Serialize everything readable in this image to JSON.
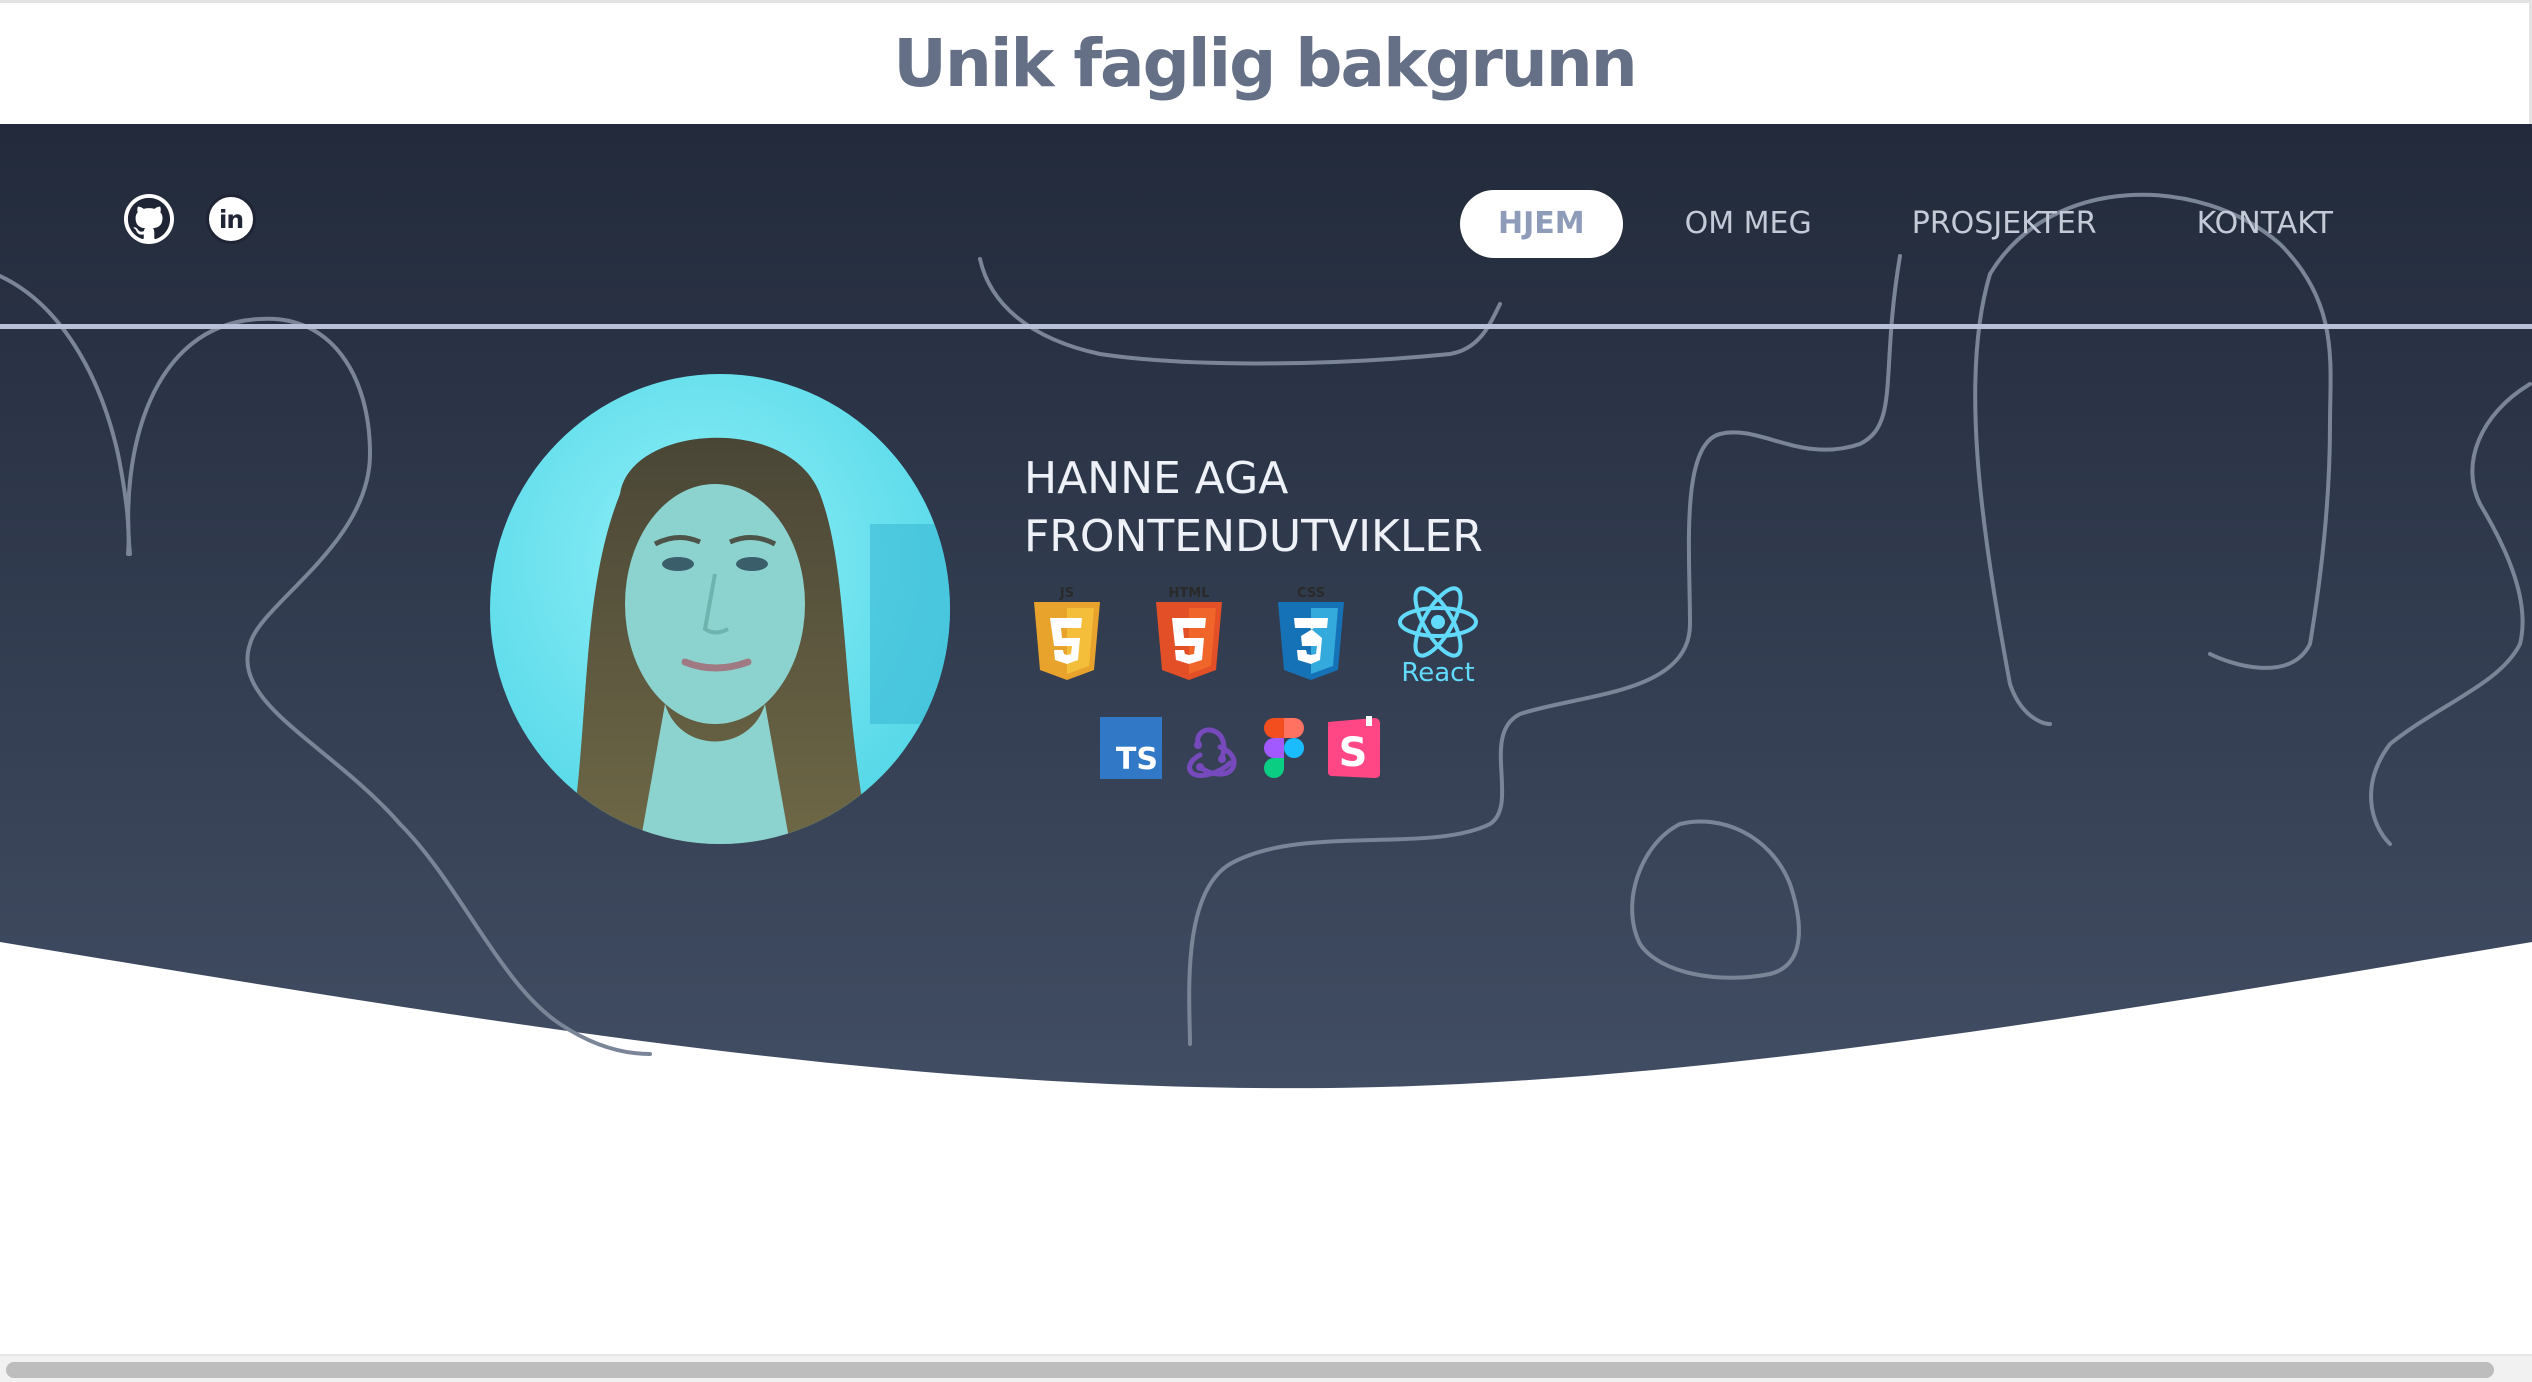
{
  "section_title": "Unik faglig bakgrunn",
  "social": [
    {
      "name": "github-icon"
    },
    {
      "name": "linkedin-icon",
      "text": "in"
    }
  ],
  "nav": {
    "items": [
      {
        "label": "HJEM",
        "active": true
      },
      {
        "label": "OM MEG",
        "active": false
      },
      {
        "label": "PROSJEKTER",
        "active": false
      },
      {
        "label": "KONTAKT",
        "active": false
      }
    ]
  },
  "profile": {
    "name": "HANNE AGA",
    "role": "FRONTENDUTVIKLER"
  },
  "tech": {
    "react_label": "React",
    "ts_label": "TS",
    "js_label": "JS",
    "html_label": "HTML",
    "css_label": "CSS",
    "storybook_label": "S"
  },
  "colors": {
    "hero_top": "#222a3b",
    "hero_bottom": "#414d63",
    "title": "#657086",
    "divider": "#b7c0d6",
    "squiggle": "#7b8598"
  }
}
